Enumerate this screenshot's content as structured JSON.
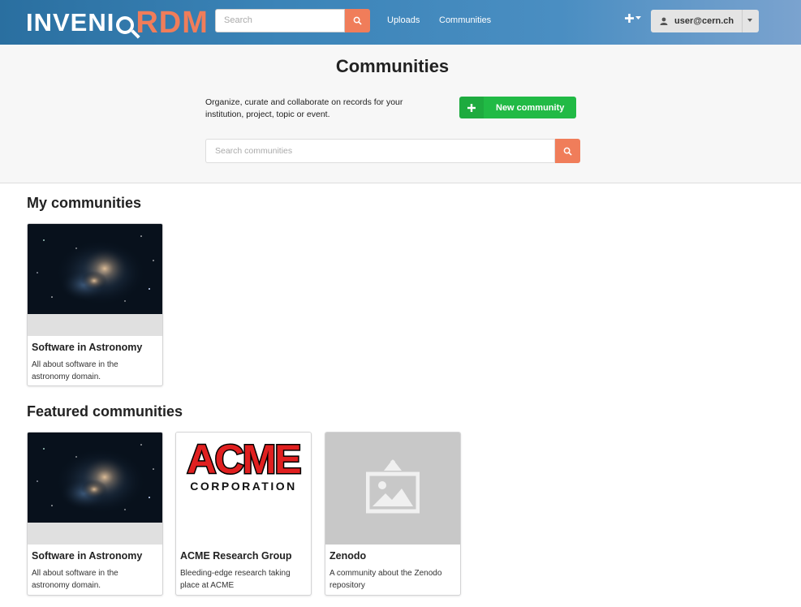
{
  "header": {
    "logo_left": "INVENI",
    "logo_right": "RDM",
    "search_placeholder": "Search",
    "nav": [
      "Uploads",
      "Communities"
    ],
    "user_label": "user@cern.ch"
  },
  "hero": {
    "title": "Communities",
    "description": "Organize, curate and collaborate on records for your institution, project, topic or event.",
    "new_button": "New community",
    "search_placeholder": "Search communities"
  },
  "my_communities": {
    "title": "My communities",
    "cards": [
      {
        "title": "Software in Astronomy",
        "description": "All about software in the astronomy domain.",
        "image": "nebula"
      }
    ]
  },
  "featured": {
    "title": "Featured communities",
    "cards": [
      {
        "title": "Software in Astronomy",
        "description": "All about software in the astronomy domain.",
        "image": "nebula"
      },
      {
        "title": "ACME Research Group",
        "description": "Bleeding-edge research taking place at ACME",
        "image": "acme-logo"
      },
      {
        "title": "Zenodo",
        "description": "A community about the Zenodo repository",
        "image": "placeholder-image-icon"
      }
    ]
  },
  "colors": {
    "accent": "#f07d5a",
    "green": "#21ba45",
    "header": "#3b84b8"
  }
}
